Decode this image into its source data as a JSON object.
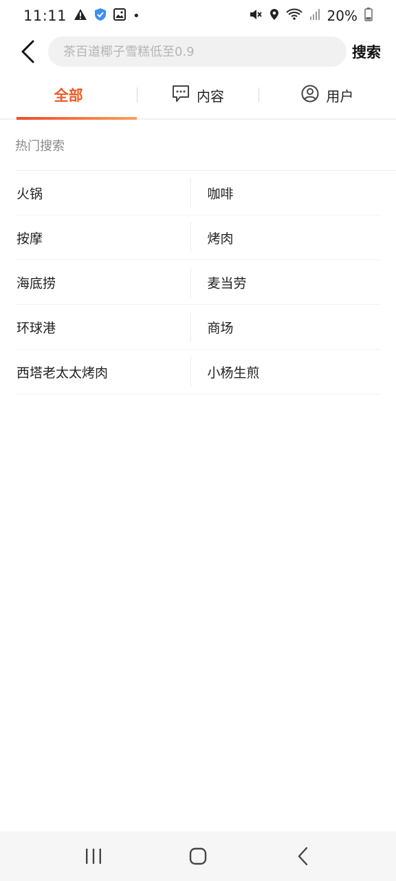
{
  "status_bar": {
    "time": "11:11",
    "battery": "20%",
    "icons": [
      "warning-icon",
      "shield-icon",
      "image-icon",
      "dot-icon",
      "mute-icon",
      "location-icon",
      "wifi-icon",
      "signal-icon",
      "battery-icon"
    ]
  },
  "search": {
    "placeholder": "茶百道椰子雪糕低至0.9",
    "value": "",
    "button_label": "搜索"
  },
  "tabs": [
    {
      "label": "全部",
      "active": true
    },
    {
      "label": "内容",
      "icon": "comment-icon",
      "active": false
    },
    {
      "label": "用户",
      "icon": "user-icon",
      "active": false
    }
  ],
  "hot_search": {
    "title": "热门搜索",
    "items": [
      "火锅",
      "咖啡",
      "按摩",
      "烤肉",
      "海底捞",
      "麦当劳",
      "环球港",
      "商场",
      "西塔老太太烤肉",
      "小杨生煎"
    ]
  },
  "colors": {
    "accent": "#ee5a24",
    "placeholder": "#b5b5b5"
  }
}
